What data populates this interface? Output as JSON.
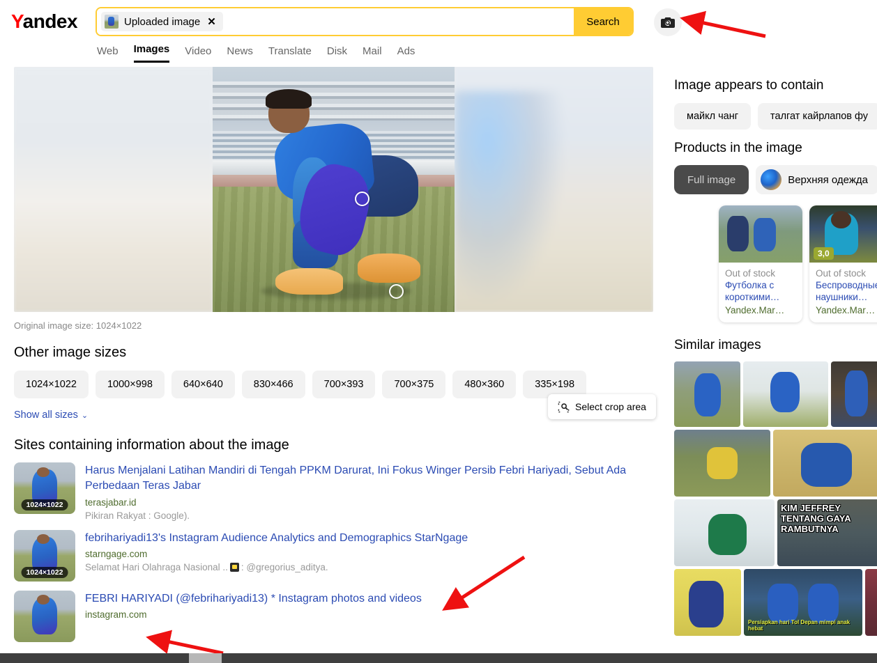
{
  "header": {
    "logo_y": "Y",
    "logo_rest": "andex",
    "search": {
      "chip_label": "Uploaded image",
      "chip_close": "✕",
      "button_label": "Search",
      "camera_icon": "camera-search-icon"
    },
    "tabs": [
      {
        "label": "Web",
        "active": false
      },
      {
        "label": "Images",
        "active": true
      },
      {
        "label": "Video",
        "active": false
      },
      {
        "label": "News",
        "active": false
      },
      {
        "label": "Translate",
        "active": false
      },
      {
        "label": "Disk",
        "active": false
      },
      {
        "label": "Mail",
        "active": false
      },
      {
        "label": "Ads",
        "active": false
      }
    ]
  },
  "main": {
    "original_size_label": "Original image size: 1024×1022",
    "crop_button": "Select crop area",
    "crop_icon": "crop-magnifier-icon",
    "sizes_heading": "Other image sizes",
    "sizes": [
      "1024×1022",
      "1000×998",
      "640×640",
      "830×466",
      "700×393",
      "700×375",
      "480×360",
      "335×198"
    ],
    "show_all_label": "Show all sizes",
    "show_all_chevron": "⌄",
    "sites_heading": "Sites containing information about the image",
    "sites": [
      {
        "title": "Harus Menjalani Latihan Mandiri di Tengah PPKM Darurat, Ini Fokus Winger Persib Febri Hariyadi, Sebut Ada Perbedaan Teras Jabar",
        "domain": "terasjabar.id",
        "description": "Pikiran Rakyat : Google).",
        "badge": "1024×1022",
        "has_icon": false
      },
      {
        "title": "febrihariyadi13's Instagram Audience Analytics and Demographics StarNgage",
        "domain": "starngage.com",
        "description_pre": "Selamat Hari Olahraga Nasional ..",
        "description_post": ": @gregorius_aditya.",
        "badge": "1024×1022",
        "has_icon": true
      },
      {
        "title": "FEBRI HARIYADI (@febrihariyadi13) * Instagram photos and videos",
        "domain": "instagram.com",
        "description": "",
        "badge": "",
        "has_icon": false
      }
    ]
  },
  "sidebar": {
    "contains_heading": "Image appears to contain",
    "contains_tags": [
      "майкл чанг",
      "талгат кайрлапов фу"
    ],
    "products_heading": "Products in the image",
    "product_filters": [
      {
        "label": "Full image",
        "selected": true
      },
      {
        "label": "Верхняя одежда",
        "selected": false
      }
    ],
    "product_cards": [
      {
        "stock": "Out of stock",
        "name": "Футболка с короткими…",
        "shop": "Yandex.Mar…",
        "rating": ""
      },
      {
        "stock": "Out of stock",
        "name": "Беспроводные наушники…",
        "shop": "Yandex.Mar…",
        "rating": "3,0"
      }
    ],
    "similar_heading": "Similar images",
    "similar_overlays": {
      "card_kim": "KIM JEFFREY TENTANG GAYA RAMBUTNYA",
      "card_bottom": "Persiapkan hari Tol Depan mimpi anak hebat"
    }
  },
  "colors": {
    "brand_yellow": "#ffcc33",
    "logo_red": "#ff0000",
    "link_blue": "#2b4bb3",
    "domain_green": "#4f6c2e",
    "annotation_red": "#ee1111",
    "chip_gray": "#f2f2f2",
    "dark_pill": "#4a4a4a",
    "rating_green": "#9aa830"
  }
}
